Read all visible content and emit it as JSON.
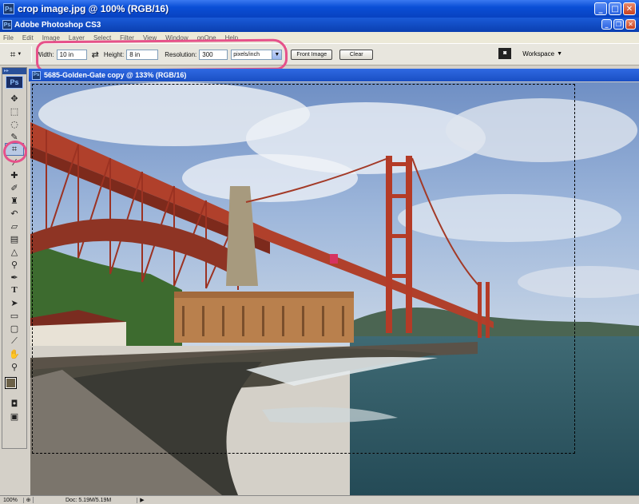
{
  "window": {
    "title": "crop image.jpg @ 100% (RGB/16)",
    "icon": "Ps"
  },
  "app": {
    "title": "Adobe Photoshop CS3",
    "icon": "Ps"
  },
  "menu": [
    "File",
    "Edit",
    "Image",
    "Layer",
    "Select",
    "Filter",
    "View",
    "Window",
    "onOne",
    "Help"
  ],
  "options": {
    "width_label": "Width:",
    "width_value": "10 in",
    "height_label": "Height:",
    "height_value": "8 in",
    "resolution_label": "Resolution:",
    "resolution_value": "300",
    "units_value": "pixels/inch",
    "front_image_label": "Front Image",
    "clear_label": "Clear",
    "workspace_label": "Workspace"
  },
  "document": {
    "title": "5685-Golden-Gate copy @ 133% (RGB/16)",
    "icon": "Ps"
  },
  "toolbox": {
    "logo": "Ps",
    "tools": [
      "move-tool",
      "marquee-tool",
      "lasso-tool",
      "quick-select-tool",
      "crop-tool",
      "slice-tool",
      "healing-brush-tool",
      "brush-tool",
      "clone-stamp-tool",
      "history-brush-tool",
      "eraser-tool",
      "gradient-tool",
      "blur-tool",
      "dodge-tool",
      "pen-tool",
      "type-tool",
      "path-select-tool",
      "shape-tool",
      "notes-tool",
      "eyedropper-tool",
      "hand-tool",
      "zoom-tool"
    ],
    "selected": "crop-tool",
    "foreground_color": "#6c6148",
    "background_color": "#111111"
  },
  "status": {
    "zoom": "100%",
    "doc": "Doc: 5.19M/5.19M"
  },
  "colors": {
    "highlight": "#e6518a",
    "title_blue": "#0a4fd6"
  }
}
